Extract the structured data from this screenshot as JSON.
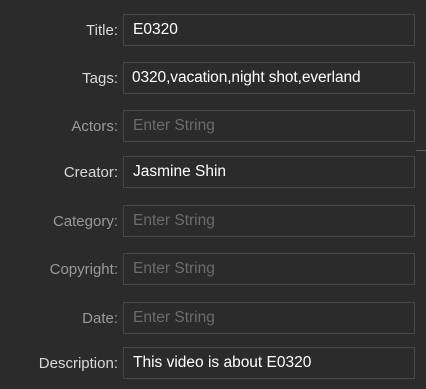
{
  "fields": [
    {
      "label": "Title:",
      "value": "E0320",
      "placeholder": ""
    },
    {
      "label": "Tags:",
      "value": "0320,vacation,night shot,everland",
      "placeholder": ""
    },
    {
      "label": "Actors:",
      "value": "",
      "placeholder": "Enter String"
    },
    {
      "label": "Creator:",
      "value": "Jasmine Shin",
      "placeholder": ""
    },
    {
      "label": "Category:",
      "value": "",
      "placeholder": "Enter String"
    },
    {
      "label": "Copyright:",
      "value": "",
      "placeholder": "Enter String"
    },
    {
      "label": "Date:",
      "value": "",
      "placeholder": "Enter String"
    },
    {
      "label": "Description:",
      "value": "This video is about E0320",
      "placeholder": ""
    }
  ]
}
